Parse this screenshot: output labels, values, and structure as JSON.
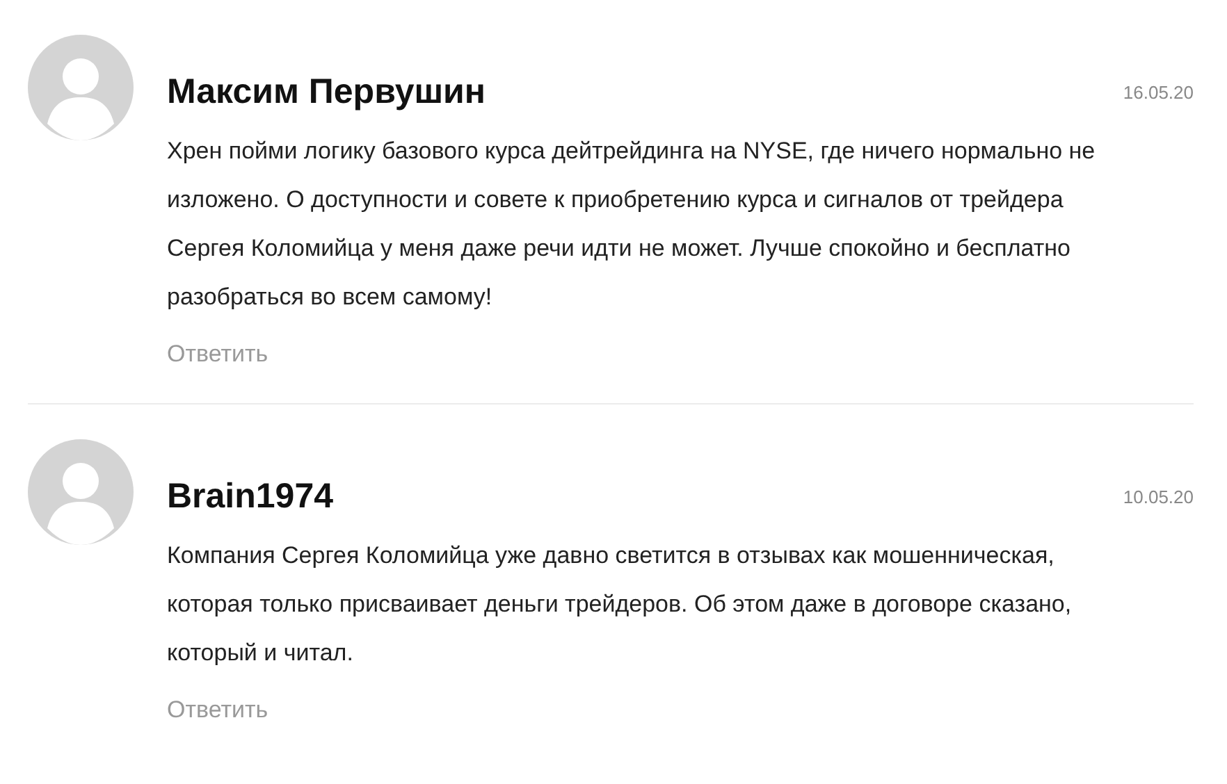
{
  "comments": [
    {
      "author": "Максим Первушин",
      "date": "16.05.20",
      "text": "Хрен пойми логику базового курса дейтрейдинга на NYSE, где ничего нормально не изложено. О доступности и совете к приобретению курса и сигналов от трейдера Сергея Коломийца у меня даже речи идти не может. Лучше спокойно и бесплатно разобраться во всем самому!",
      "reply": "Ответить"
    },
    {
      "author": "Brain1974",
      "date": "10.05.20",
      "text": "Компания Сергея Коломийца уже давно светится в отзывах как мошенническая, которая только присваивает деньги трейдеров. Об этом даже в договоре сказано, который и читал.",
      "reply": "Ответить"
    }
  ]
}
